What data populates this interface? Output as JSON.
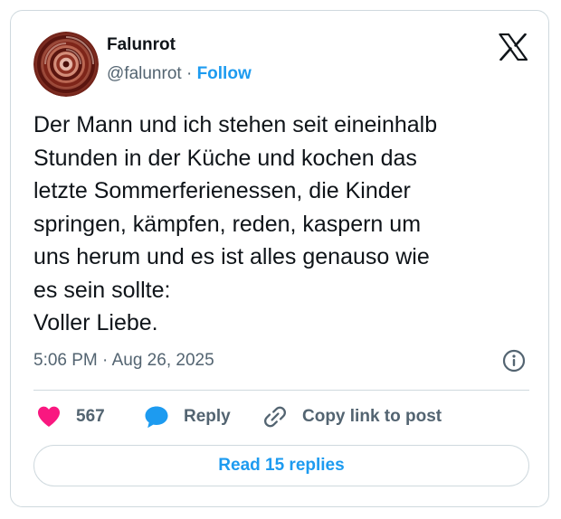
{
  "author": {
    "name": "Falunrot",
    "handle": "@falunrot",
    "separator": "·",
    "follow_label": "Follow",
    "avatar_icon": "spiral-avatar"
  },
  "platform_icon": "x-logo-icon",
  "tweet": {
    "text": "Der Mann und ich stehen seit eineinhalb\nStunden in der Küche und kochen das\nletzte Sommerferienessen, die Kinder\nspringen, kämpfen, reden, kaspern um\nuns herum und es ist alles genauso wie\nes sein sollte:\nVoller Liebe.",
    "timestamp": "5:06 PM · Aug 26, 2025"
  },
  "actions": {
    "likes_count": "567",
    "reply_label": "Reply",
    "copy_link_label": "Copy link to post"
  },
  "read_replies_label": "Read 15 replies",
  "colors": {
    "accent": "#1d9bf0",
    "like": "#f91880",
    "text": "#0f1419",
    "muted": "#536471",
    "border": "#cfd9de"
  }
}
